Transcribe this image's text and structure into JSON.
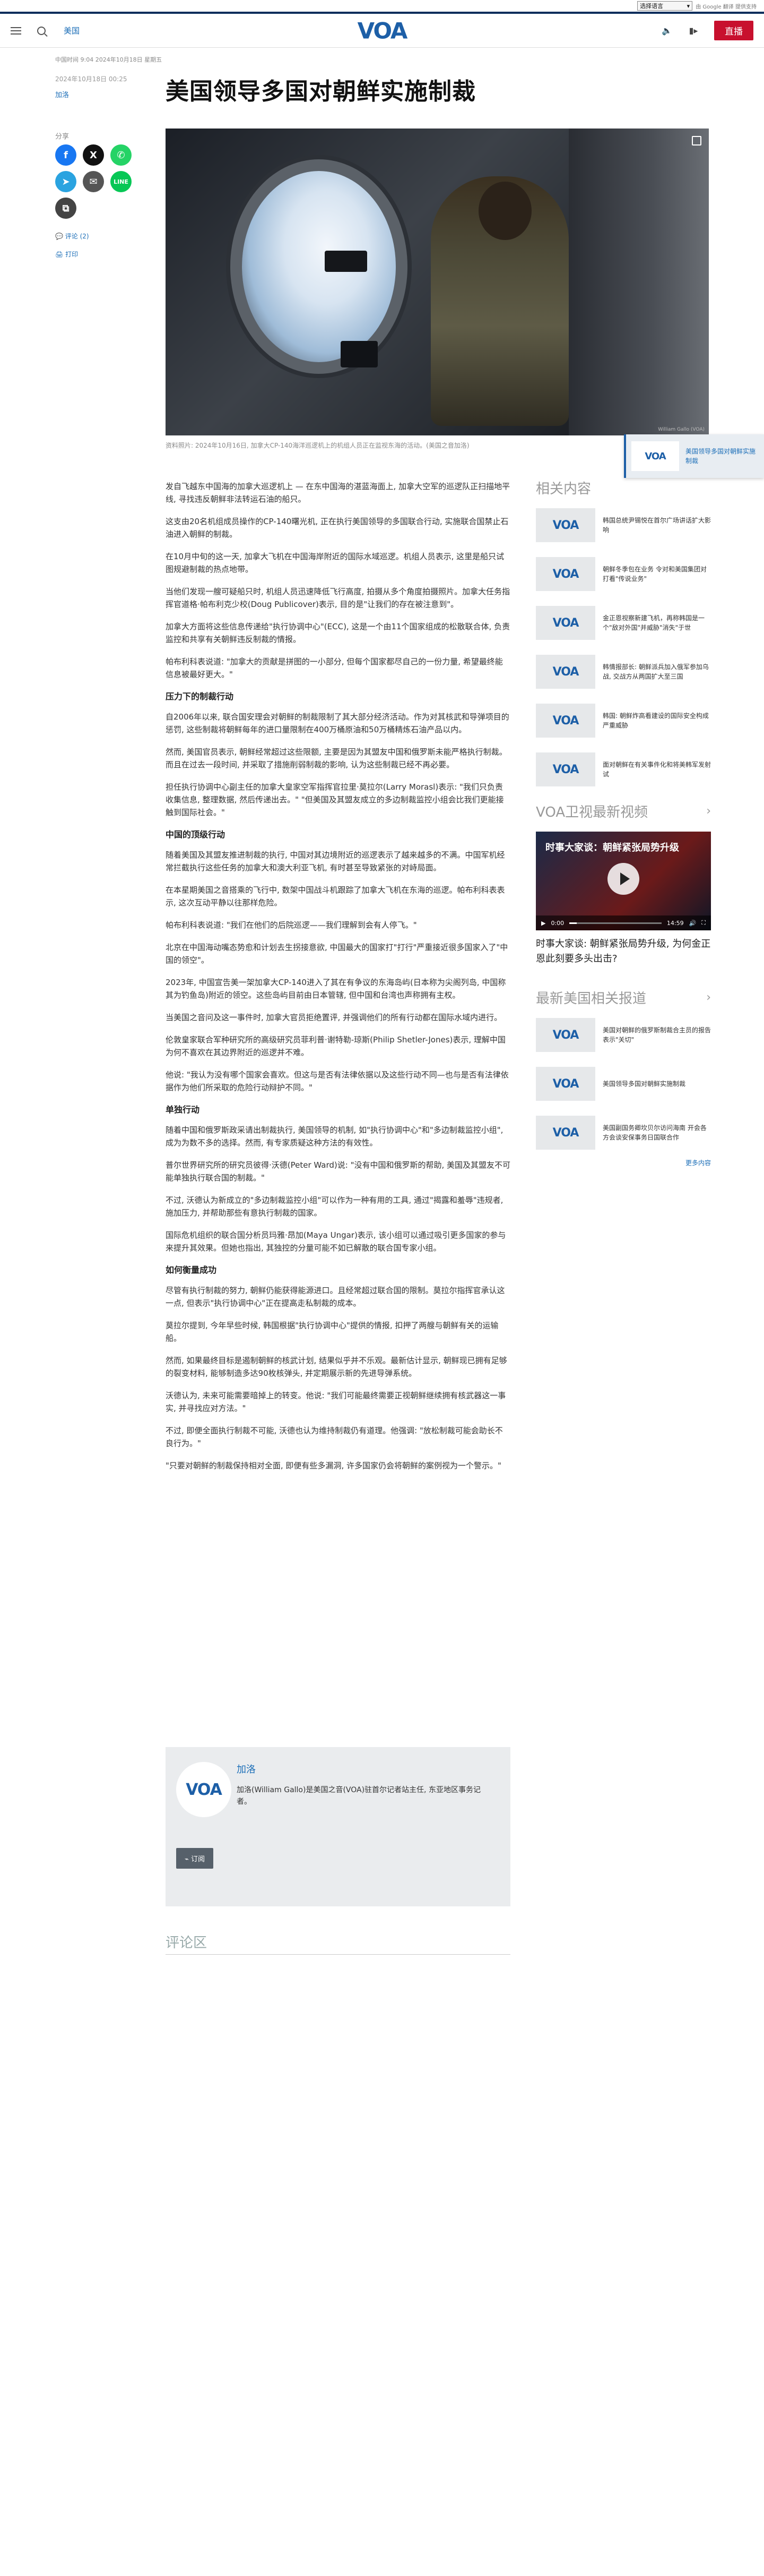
{
  "lang_bar": {
    "select_label": "选择语言",
    "powered_by": "由 Google 翻译 提供支持",
    "google": "Google",
    "translate": "翻译"
  },
  "header": {
    "region": "美国",
    "logo": "VOA",
    "live": "直播"
  },
  "article": {
    "breadcrumb": "中国时间 9:04 2024年10月18日 星期五",
    "date": "2024年10月18日 00:25",
    "author": "加洛",
    "title": "美国领导多国对朝鲜实施制裁",
    "image_credit": "William Gallo (VOA)",
    "caption": "资料照片: 2024年10月16日, 加拿大CP-140海洋巡逻机上的机组人员正在监视东海的活动。(美国之音加洛)"
  },
  "share": {
    "label": "分享",
    "comments": "评论 (2)",
    "print": "打印"
  },
  "body": [
    {
      "type": "p",
      "text": "发自飞越东中国海的加拿大巡逻机上 — 在东中国海的湛蓝海面上, 加拿大空军的巡逻队正扫描地平线, 寻找违反朝鲜非法转运石油的船只。"
    },
    {
      "type": "p",
      "text": "这支由20名机组成员操作的CP-140曙光机, 正在执行美国领导的多国联合行动, 实施联合国禁止石油进入朝鲜的制裁。"
    },
    {
      "type": "p",
      "text": "在10月中旬的这一天, 加拿大飞机在中国海岸附近的国际水域巡逻。机组人员表示, 这里是船只试图规避制裁的热点地带。"
    },
    {
      "type": "p",
      "text": "当他们发现一艘可疑船只时, 机组人员迅速降低飞行高度, 拍摄从多个角度拍摄照片。加拿大任务指挥官道格·帕布利克少校(Doug Publicover)表示, 目的是\"让我们的存在被注意到\"。"
    },
    {
      "type": "p",
      "text": "加拿大方面将这些信息传递给\"执行协调中心\"(ECC), 这是一个由11个国家组成的松散联合体, 负责监控和共享有关朝鲜违反制裁的情报。"
    },
    {
      "type": "p",
      "text": "帕布利科表说道: \"加拿大的贡献是拼图的一小部分, 但每个国家都尽自己的一份力量, 希望最终能信息被最好更大。\""
    },
    {
      "type": "h",
      "text": "压力下的制裁行动"
    },
    {
      "type": "p",
      "text": "自2006年以来, 联合国安理会对朝鲜的制裁限制了其大部分经济活动。作为对其核武和导弹项目的惩罚, 这些制裁将朝鲜每年的进口量限制在400万桶原油和50万桶精炼石油产品以内。"
    },
    {
      "type": "p",
      "text": "然而, 美国官员表示, 朝鲜经常超过这些限额, 主要是因为其盟友中国和俄罗斯未能严格执行制裁。而且在过去一段时间, 并采取了措施削弱制裁的影响, 认为这些制裁已经不再必要。"
    },
    {
      "type": "p",
      "text": "担任执行协调中心副主任的加拿大皇家空军指挥官拉里·莫拉尔(Larry Morasl)表示: \"我们只负责收集信息, 整理数据, 然后传递出去。\" \"但美国及其盟友成立的多边制裁监控小组会比我们更能接触到国际社会。\""
    },
    {
      "type": "h",
      "text": "中国的顶级行动"
    },
    {
      "type": "p",
      "text": "随着美国及其盟友推进制裁的执行, 中国对其边境附近的巡逻表示了越来越多的不满。中国军机经常拦截执行这些任务的加拿大和澳大利亚飞机, 有时甚至导致紧张的对峙局面。"
    },
    {
      "type": "p",
      "text": "在本星期美国之音搭乘的飞行中, 数架中国战斗机跟踪了加拿大飞机在东海的巡逻。帕布利科表表示, 这次互动平静以往那样危险。"
    },
    {
      "type": "p",
      "text": "帕布利科表说道: \"我们在他们的后院巡逻——我们理解到会有人停飞。\""
    },
    {
      "type": "p",
      "text": "北京在中国海动嘴态势愈和计划去生拐接意欲, 中国最大的国家打\"打行\"严重接近很多国家入了\"中国的领空\"。"
    },
    {
      "type": "p",
      "text": "2023年, 中国宣告美一架加拿大CP-140进入了其在有争议的东海岛屿(日本称为尖阁列岛, 中国称其为钓鱼岛)附近的领空。这些岛屿目前由日本管辖, 但中国和台湾也声称拥有主权。"
    },
    {
      "type": "p",
      "text": "当美国之音问及这一事件时, 加拿大官员拒绝置评, 并强调他们的所有行动都在国际水域内进行。"
    },
    {
      "type": "p",
      "text": "伦敦皇家联合军种研究所的高级研究员菲利普·谢特勒-琼斯(Philip Shetler-Jones)表示, 理解中国为何不喜欢在其边界附近的巡逻并不难。"
    },
    {
      "type": "p",
      "text": "他说: \"我认为没有哪个国家会喜欢。但这与是否有法律依据以及这些行动不同—也与是否有法律依据作为他们所采取的危险行动辩护不同。\""
    },
    {
      "type": "h",
      "text": "单独行动"
    },
    {
      "type": "p",
      "text": "随着中国和俄罗斯政采请出制裁执行, 美国领导的机制, 如\"执行协调中心\"和\"多边制裁监控小组\", 成为为数不多的选择。然而, 有专家质疑这种方法的有效性。"
    },
    {
      "type": "p",
      "text": "普尔世界研究所的研究员彼得·沃德(Peter Ward)说: \"没有中国和俄罗斯的帮助, 美国及其盟友不可能单独执行联合国的制裁。\""
    },
    {
      "type": "p",
      "text": "不过, 沃德认为新成立的\"多边制裁监控小组\"可以作为一种有用的工具, 通过\"揭露和羞辱\"违规者, 施加压力, 并帮助那些有意执行制裁的国家。"
    },
    {
      "type": "p",
      "text": "国际危机组织的联合国分析员玛雅·昂加(Maya Ungar)表示, 该小组可以通过吸引更多国家的参与来提升其效果。但她也指出, 其独控的分量可能不如已解散的联合国专家小组。"
    },
    {
      "type": "h",
      "text": "如何衡量成功"
    },
    {
      "type": "p",
      "text": "尽管有执行制裁的努力, 朝鲜仍能获得能源进口。且经常超过联合国的限制。莫拉尔指挥官承认这一点, 但表示\"执行协调中心\"正在提高走私制裁的成本。"
    },
    {
      "type": "p",
      "text": "莫拉尔提到, 今年早些时候, 韩国根据\"执行协调中心\"提供的情报, 扣押了两艘与朝鲜有关的运输船。"
    },
    {
      "type": "p",
      "text": "然而, 如果最终目标是遏制朝鲜的核武计划, 结果似乎并不乐观。最新估计显示, 朝鲜现已拥有足够的裂变材料, 能够制造多达90枚核弹头, 并定期展示新的先进导弹系统。"
    },
    {
      "type": "p",
      "text": "沃德认为, 未来可能需要暗掉上的转变。他说: \"我们可能最终需要正视朝鲜继续拥有核武器这一事实, 并寻找应对方法。\""
    },
    {
      "type": "p",
      "text": "不过, 即便全面执行制裁不可能, 沃德也认为维持制裁仍有道理。他强调: \"放松制裁可能会助长不良行为。\""
    },
    {
      "type": "p",
      "text": "\"只要对朝鲜的制裁保持相对全面, 即便有些多漏洞, 许多国家仍会将朝鲜的案例视为一个警示。\""
    }
  ],
  "author_box": {
    "name": "加洛",
    "bio": "加洛(William Gallo)是美国之音(VOA)驻首尔记者站主任, 东亚地区事务记者。",
    "subscribe": "订阅",
    "avatar_text": "VOA"
  },
  "comments_title": "评论区",
  "float_card": {
    "thumb": "VOA",
    "text": "美国领导多国对朝鲜实施制裁"
  },
  "rail": {
    "related_title": "相关内容",
    "related": [
      {
        "thumb": "VOA",
        "text": "韩国总统尹锡悦在首尔广场讲话扩大影响"
      },
      {
        "thumb": "VOA",
        "text": "朝鲜冬季包在业务 令对和美国集团对打看\"传说业务\""
      },
      {
        "thumb": "VOA",
        "text": "金正恩视察新建飞机，再称韩国是一个\"敌对外国\"并威胁\"消失\"于世"
      },
      {
        "thumb": "VOA",
        "text": "韩情报部长: 朝鲜派兵加入俄军参加乌战, 交战方从两国扩大至三国"
      },
      {
        "thumb": "VOA",
        "text": "韩国: 朝鲜炸高看建设的国际安全构成严重威胁"
      },
      {
        "thumb": "VOA",
        "text": "面对朝鲜在有关事件化和将美韩军发射试"
      }
    ],
    "video_title": "VOA卫视最新视频",
    "video_overlay": "时事大家谈：朝鲜紧张局势升级",
    "video_time": "0:00",
    "video_duration": "14:59",
    "video_caption": "时事大家谈: 朝鲜紧张局势升级, 为何金正恩此刻要多头出击?",
    "latest_title": "最新美国相关报道",
    "latest": [
      {
        "thumb": "VOA",
        "text": "美国对朝鲜的俄罗斯制裁合主员的报告表示\"关切\""
      },
      {
        "thumb": "VOA",
        "text": "美国领导多国对朝鲜实施制裁"
      },
      {
        "thumb": "VOA",
        "text": "美国副国务卿坎贝尔访问海南 开会各方会谈安保事务日国联合作"
      }
    ],
    "more": "更多内容"
  },
  "colors": {
    "brand": "#1d5fa7",
    "live": "#c8102e",
    "facebook": "#1877f2",
    "x": "#111111",
    "whatsapp": "#25d366",
    "telegram": "#2aa3e0",
    "email": "#555555",
    "line": "#06c755",
    "copy": "#444444"
  }
}
